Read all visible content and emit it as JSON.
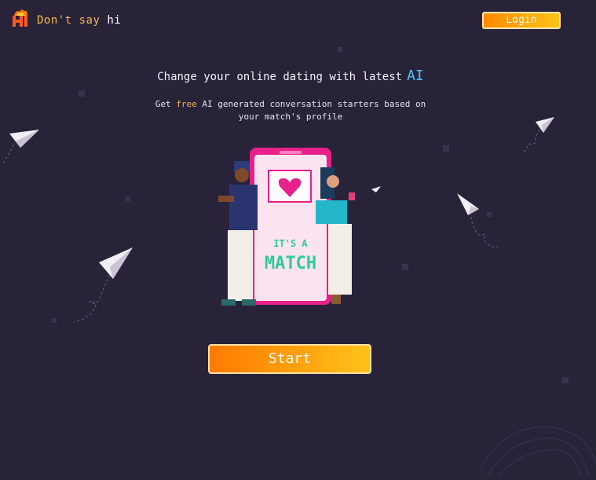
{
  "header": {
    "brand_words": [
      "Don't",
      "say",
      "hi"
    ],
    "login_label": "Login"
  },
  "hero": {
    "headline_text": "Change your online dating with latest",
    "headline_highlight": "AI",
    "subtitle_pre": "Get",
    "subtitle_highlight": "free",
    "subtitle_post": "AI generated conversation starters based on your match's profile",
    "illustration_text_line1": "IT'S A",
    "illustration_text_line2": "MATCH",
    "start_label": "Start"
  },
  "colors": {
    "background": "#29233a",
    "accent_orange": "#ff8a00",
    "accent_yellow": "#ffc21a",
    "ai_blue": "#4fc3f7",
    "phone_pink": "#e8208a",
    "match_green": "#2ecc9a"
  },
  "icons": {
    "logo": "hi-flame-logo",
    "decor": "paper-plane-icon",
    "heart": "heart-icon"
  }
}
